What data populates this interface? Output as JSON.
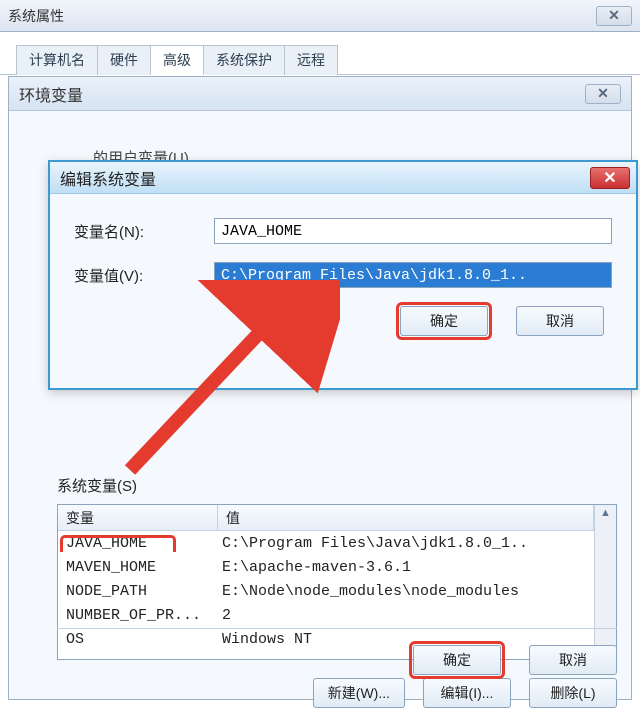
{
  "sysprops": {
    "title": "系统属性",
    "tabs": [
      "计算机名",
      "硬件",
      "高级",
      "系统保护",
      "远程"
    ],
    "active_tab_index": 2
  },
  "envvars": {
    "title": "环境变量",
    "uservars_hint": "的用户变量(U)",
    "sysvars_label": "系统变量(S)",
    "columns": {
      "name": "变量",
      "value": "值"
    },
    "rows": [
      {
        "name": "JAVA_HOME",
        "value": "C:\\Program Files\\Java\\jdk1.8.0_1.."
      },
      {
        "name": "MAVEN_HOME",
        "value": "E:\\apache-maven-3.6.1"
      },
      {
        "name": "NODE_PATH",
        "value": "E:\\Node\\node_modules\\node_modules"
      },
      {
        "name": "NUMBER_OF_PR...",
        "value": "2"
      },
      {
        "name": "OS",
        "value": "Windows NT"
      }
    ],
    "buttons": {
      "new": "新建(W)...",
      "edit": "编辑(I)...",
      "delete": "删除(L)",
      "ok": "确定",
      "cancel": "取消"
    }
  },
  "editvar": {
    "title": "编辑系统变量",
    "name_label": "变量名(N):",
    "value_label": "变量值(V):",
    "name_value": "JAVA_HOME",
    "value_value": "C:\\Program Files\\Java\\jdk1.8.0_1..",
    "ok": "确定",
    "cancel": "取消"
  },
  "icons": {
    "close_x": "✕",
    "up": "▲",
    "down": "▼"
  }
}
